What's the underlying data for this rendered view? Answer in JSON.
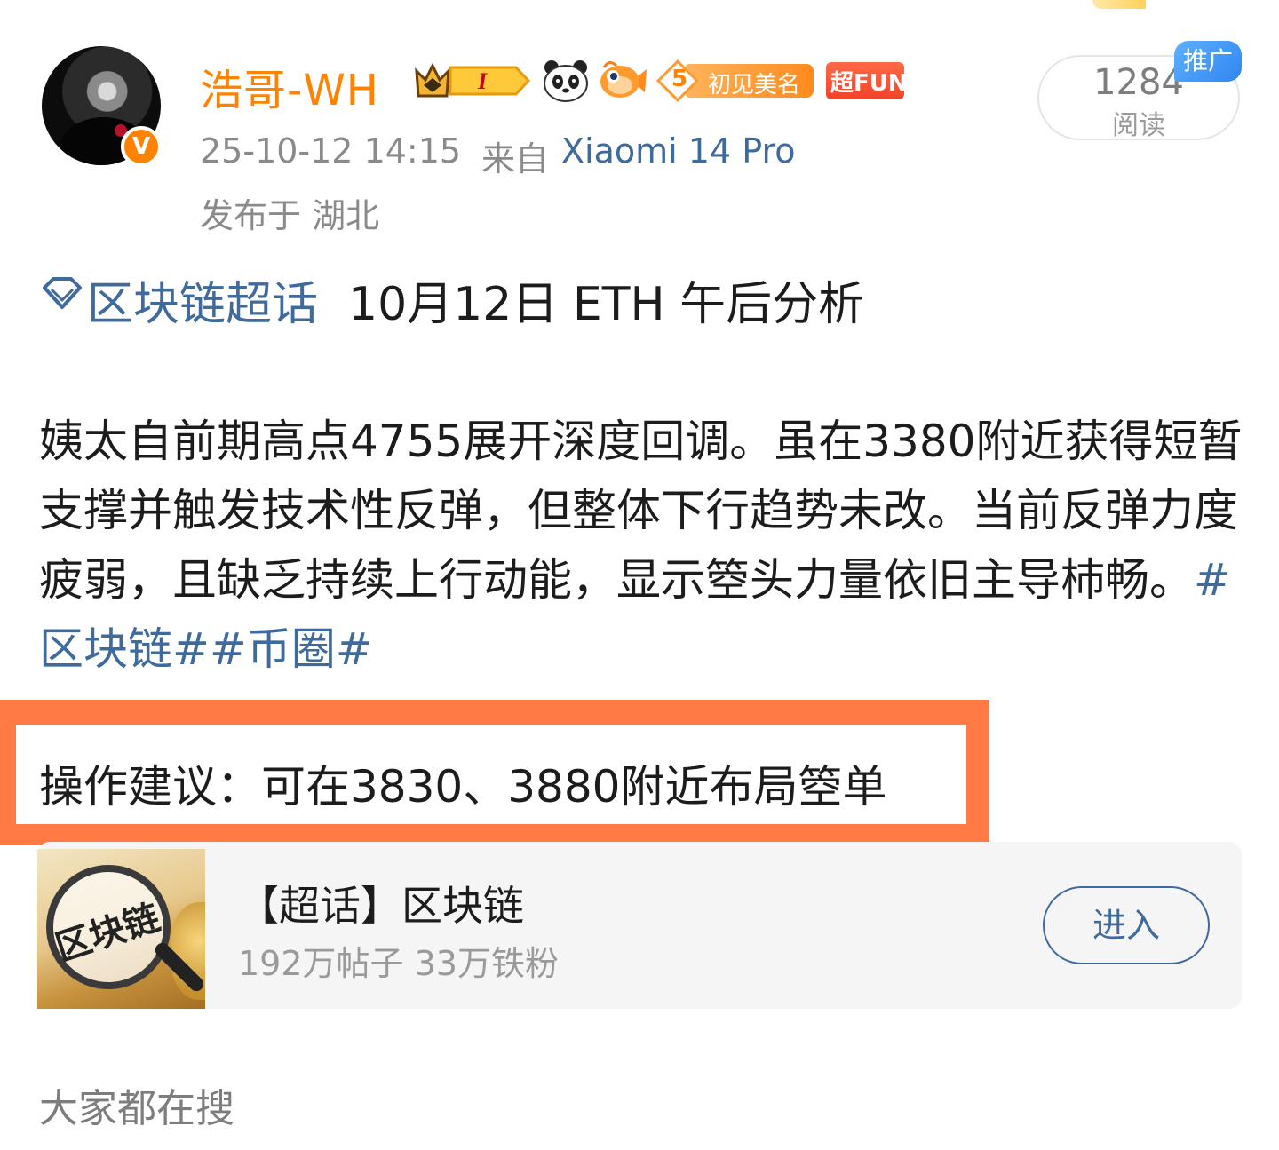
{
  "post": {
    "author": {
      "name": "浩哥-WH",
      "verified_mark": "V",
      "badges": [
        "crown-level-badge",
        "panda-icon",
        "fish-icon",
        "chujian-badge",
        "superfun-badge"
      ],
      "crown_level": "I",
      "chujian_level": "5",
      "chujian_label": "初见美名",
      "superfun_label": "超FUN"
    },
    "meta": {
      "time": "25-10-12 14:15",
      "from_label": "来自",
      "device": "Xiaomi 14 Pro",
      "location": "发布于 湖北"
    },
    "reads": {
      "count": "1284",
      "label": "阅读",
      "promo": "推广"
    },
    "topic": {
      "name": "区块链超话",
      "title": "10月12日 ETH 午后分析"
    },
    "body": {
      "text": "姨太自前期高点4755展开深度回调。虽在3380附近获得短暂支撑并触发技术性反弹，但整体下行趋势未改。当前反弹力度疲弱，且缺乏持续上行动能，显示箜头力量依旧主导杮畅。",
      "hashtags": [
        "#区块链#",
        "#币圈#"
      ]
    },
    "advice": "操作建议：可在3830、3880附近布局箜单"
  },
  "topic_card": {
    "thumb_text": "区块链",
    "title": "【超话】区块链",
    "stats": "192万帖子 33万铁粉",
    "enter_label": "进入"
  },
  "section": {
    "title": "大家都在搜"
  },
  "colors": {
    "username": "#ff8200",
    "link": "#3f6a9e",
    "highlight_border": "#ff7a45",
    "meta_gray": "#8a8a8a",
    "promo_blue": "#2f86f0"
  }
}
